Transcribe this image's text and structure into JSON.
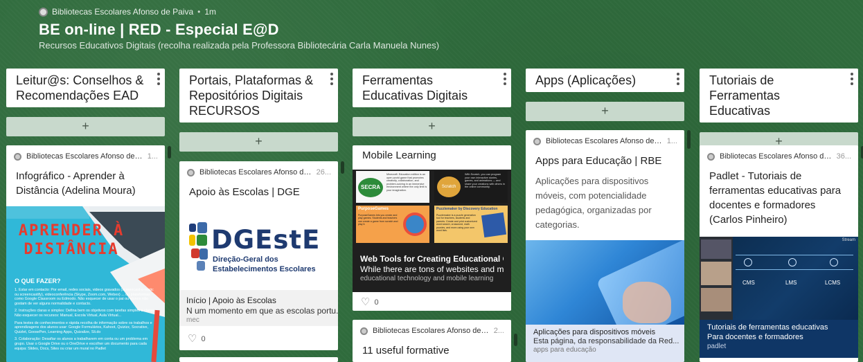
{
  "header": {
    "author": "Bibliotecas Escolares Afonso de Paiva",
    "separator": "•",
    "time": "1m",
    "title": "BE on-line | RED - Especial E@D",
    "subtitle": "Recursos Educativos Digitais (recolha realizada pela Professora Bibliotecária Carla Manuela Nunes)"
  },
  "add_label": "+",
  "columns": [
    {
      "title": "Leitur@s: Conselhos & Recomendações EAD",
      "cards": [
        {
          "author": "Bibliotecas Escolares Afonso de Paiva",
          "time": "1...",
          "title": "Infográfico - Aprender à Distância (Adelina Moura)",
          "image": {
            "headline": "APRENDER À DISTÂNCIA",
            "subhead": "O QUE FAZER?",
            "items": [
              "1. Estar em contacto: Por email, redes sociais, videos gravados (screencast-o-matic ou screencastify), videoconferência (Skype, Zoom.com, Webex) ... ou plataformas como Google Classroom ou Edmodo. Não esquecer de usar o pai ou alunos não gostam de ver alguns normalidade e contacto.",
              "2. Instruções claras e simples: Defina bem os objetivos com tarefas simples e claras. Não esquecer os recursos: Manual, Escola Virtual, Aula Virtual...",
              "Para testes de conhecimentos e rápida recolha de informação sobre os trabalhos e aprendizagens dos alunos usar: Google Formulários, Kahoot, Quizizz, Socrative, Quizlet, GoosePen, Learning Apps, Quizalize, Sli.do",
              "3. Colaboração: Desafiar os alunos a trabalharem em conta ou um problema em grupo. Usar o Google Drive ou o OneDrive e escolher um documento para cada equipa: Slides, Docs, Sites ou criar um mural no Padlet"
            ]
          }
        }
      ]
    },
    {
      "title": "Portais, Plataformas & Repositórios Digitais RECURSOS",
      "cards": [
        {
          "author": "Bibliotecas Escolares Afonso de...",
          "time": "26...",
          "title": "Apoio às Escolas | DGE",
          "logo": {
            "mark": "DGEstE",
            "line1": "Direção-Geral dos",
            "line2": "Estabelecimentos Escolares"
          },
          "link": {
            "title": "Início | Apoio às Escolas",
            "desc": "N um momento em que as escolas portu...",
            "source": "mec"
          },
          "likes": "0"
        }
      ]
    },
    {
      "title": "Ferramentas Educativas Digitais",
      "cards": [
        {
          "title": "Mobile Learning",
          "thumbs": [
            {
              "label": "SECRA",
              "text": "Minecraft: Education edition is an open-world game that promotes creativity, collaboration, and problem-solving in an immersive environment where the only limit is your imagination."
            },
            {
              "label": "Scratch",
              "text": "With Scratch, you can program your own interactive stories, games, and animations — and share your creations with others in the online community."
            },
            {
              "label": "PurposeGames",
              "text": "PurposeGames lets you create and play games. Students and teachers can create a game from scratch and play it."
            },
            {
              "label": "Puzzlemaker by Discovery Education",
              "text": "Puzzlemaker is a puzzle generation tool for teachers, students and parents. Create and print customized word search, crossword, math puzzles, and more-using your own word lists."
            }
          ],
          "link": {
            "title": "Web Tools for Creating Educational Gam...",
            "desc": "While there are tons of websites and mo...",
            "source": "educational technology and mobile learning"
          },
          "likes": "0"
        },
        {
          "author": "Bibliotecas Escolares Afonso de Paiva",
          "time": "2...",
          "title": "11 useful formative"
        }
      ]
    },
    {
      "title": "Apps (Aplicações)",
      "cards": [
        {
          "author": "Bibliotecas Escolares Afonso de Paiva",
          "time": "1...",
          "title": "Apps para Educação | RBE",
          "body": "Aplicações para dispositivos móveis, com potencialidade pedagógica, organizadas por categorias.",
          "link": {
            "title": "Aplicações para dispositivos móveis",
            "desc": "Esta página, da responsabilidade da Red...",
            "source": "apps para educação"
          }
        }
      ]
    },
    {
      "title": "Tutoriais de Ferramentas Educativas",
      "cards": [
        {
          "author": "Bibliotecas Escolares Afonso de Paiva",
          "time": "36...",
          "title": "Padlet - Tutoriais de ferramentas educativas para docentes e formadores (Carlos Pinheiro)",
          "slide": {
            "corner": "Stream",
            "nodes": [
              "CMS",
              "LMS",
              "LCMS"
            ]
          },
          "link": {
            "title": "Tutoriais de ferramentas educativas",
            "desc": "Para docentes e formadores",
            "source": "padlet"
          }
        }
      ]
    }
  ]
}
